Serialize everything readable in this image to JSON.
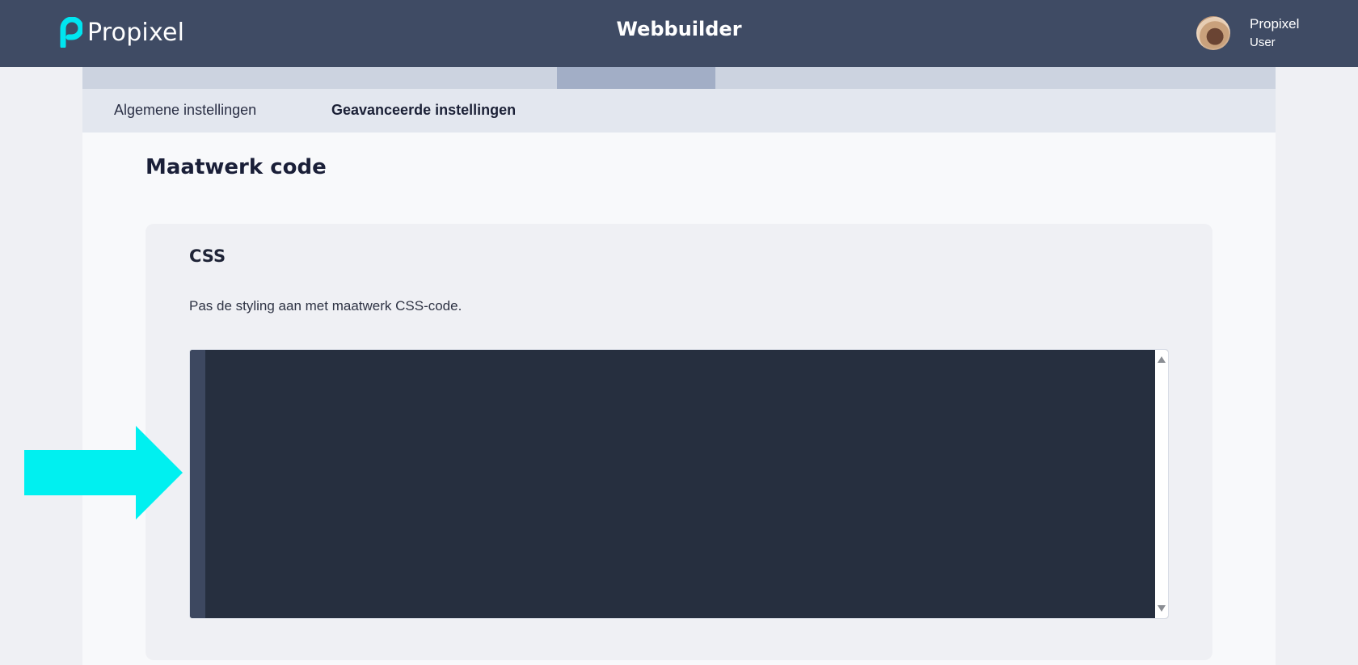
{
  "header": {
    "logo_text": "Propixel",
    "app_title": "Webbuilder",
    "user": {
      "name": "Propixel",
      "role": "User"
    }
  },
  "tabs": [
    {
      "label": "Algemene instellingen",
      "active": false
    },
    {
      "label": "Geavanceerde instellingen",
      "active": true
    }
  ],
  "section": {
    "title": "Maatwerk code",
    "card": {
      "title": "CSS",
      "description": "Pas de styling aan met maatwerk CSS-code.",
      "editor_value": ""
    }
  },
  "colors": {
    "header_bg": "#3f4b64",
    "accent": "#00e5f0",
    "editor_bg": "#262f3f"
  },
  "icons": {
    "logo": "propixel-logo-icon",
    "annotation": "arrow-right-icon"
  }
}
